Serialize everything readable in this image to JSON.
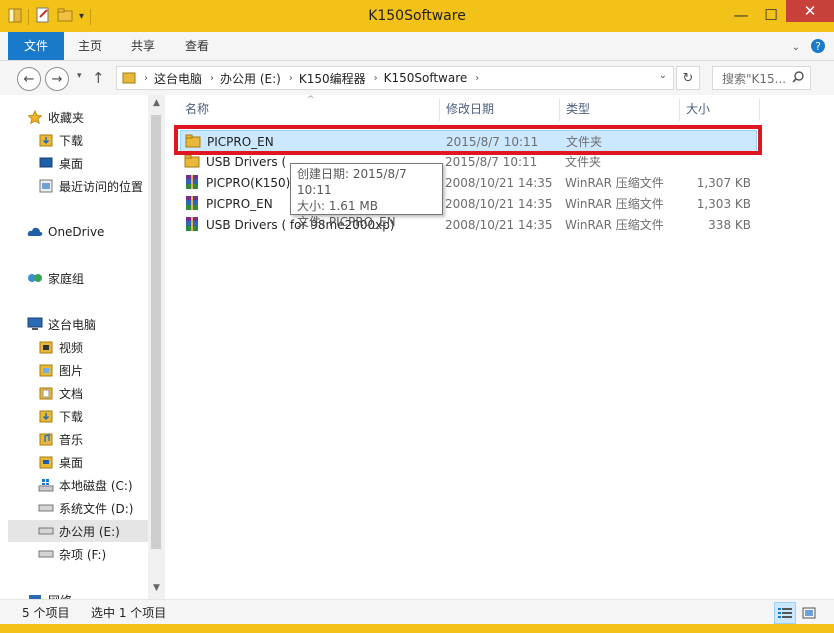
{
  "window": {
    "title": "K150Software",
    "controls": {
      "minimize": "—",
      "maximize": "☐",
      "close": "✕"
    }
  },
  "ribbon": {
    "tabs": [
      "文件",
      "主页",
      "共享",
      "查看"
    ]
  },
  "address": {
    "crumbs": [
      "这台电脑",
      "办公用 (E:)",
      "K150编程器",
      "K150Software"
    ],
    "search_placeholder": "搜索\"K15..."
  },
  "columns": {
    "name": "名称",
    "date": "修改日期",
    "type": "类型",
    "size": "大小"
  },
  "files": [
    {
      "name": "PICPRO_EN",
      "date": "2015/8/7 10:11",
      "type": "文件夹",
      "size": "",
      "icon": "folder-icon"
    },
    {
      "name": "USB Drivers (",
      "date": "2015/8/7 10:11",
      "type": "文件夹",
      "size": "",
      "icon": "folder-icon"
    },
    {
      "name": "PICPRO(K150)",
      "date": "2008/10/21 14:35",
      "type": "WinRAR 压缩文件",
      "size": "1,307 KB",
      "icon": "winrar-archive-icon"
    },
    {
      "name": "PICPRO_EN",
      "date": "2008/10/21 14:35",
      "type": "WinRAR 压缩文件",
      "size": "1,303 KB",
      "icon": "winrar-archive-icon"
    },
    {
      "name": "USB Drivers ( for 98me2000xp)",
      "date": "2008/10/21 14:35",
      "type": "WinRAR 压缩文件",
      "size": "338 KB",
      "icon": "winrar-archive-icon"
    }
  ],
  "tooltip": {
    "line1": "创建日期: 2015/8/7 10:11",
    "line2": "大小: 1.61 MB",
    "line3": "文件: PICPRO_EN"
  },
  "nav": {
    "favorites": "收藏夹",
    "downloads": "下载",
    "desktop": "桌面",
    "recent": "最近访问的位置",
    "onedrive": "OneDrive",
    "homegroup": "家庭组",
    "this_pc": "这台电脑",
    "videos": "视频",
    "pictures": "图片",
    "documents": "文档",
    "downloads2": "下载",
    "music": "音乐",
    "desktop2": "桌面",
    "drive_c": "本地磁盘 (C:)",
    "drive_d": "系统文件 (D:)",
    "drive_e": "办公用 (E:)",
    "drive_f": "杂项 (F:)",
    "network": "网络"
  },
  "status": {
    "count": "5 个项目",
    "selected": "选中 1 个项目"
  },
  "colors": {
    "accent": "#1979ca",
    "frame": "#f2c218",
    "selection": "#cce8ff",
    "highlight_box": "#e01622"
  }
}
